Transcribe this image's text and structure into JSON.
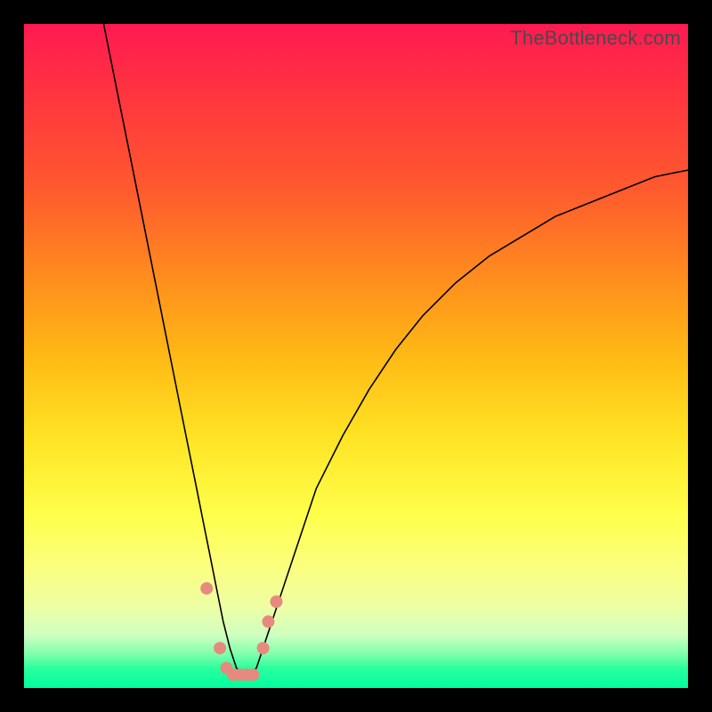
{
  "watermark": "TheBottleneck.com",
  "colors": {
    "frame": "#000000",
    "curve": "#000000",
    "marker": "#e78a7e",
    "gradient_stops": [
      "#ff1a52",
      "#ff5a2e",
      "#ffb915",
      "#ffff4b",
      "#edffa6",
      "#00ff9d"
    ]
  },
  "chart_data": {
    "type": "line",
    "title": "",
    "xlabel": "",
    "ylabel": "",
    "xlim": [
      0,
      100
    ],
    "ylim": [
      0,
      100
    ],
    "x": [
      12,
      14,
      16,
      18,
      20,
      22,
      24,
      26,
      27,
      28,
      29,
      30,
      31,
      32,
      33,
      34,
      35,
      36,
      38,
      40,
      42,
      44,
      48,
      52,
      56,
      60,
      65,
      70,
      75,
      80,
      85,
      90,
      95,
      100
    ],
    "y": [
      100,
      90,
      80,
      70,
      60,
      50,
      40,
      30,
      25,
      20,
      15,
      10,
      6,
      3,
      2,
      2,
      3,
      6,
      12,
      18,
      24,
      30,
      38,
      45,
      51,
      56,
      61,
      65,
      68,
      71,
      73,
      75,
      77,
      78
    ],
    "markers": {
      "x": [
        27.5,
        29.5,
        30.5,
        31.5,
        32.5,
        33.5,
        34.5,
        36.0,
        36.8,
        38.0
      ],
      "y": [
        15,
        6,
        3,
        2,
        2,
        2,
        2,
        6,
        10,
        13
      ]
    },
    "notes": "V-shaped bottleneck curve. Values are visual estimates (no axis ticks present). y≈0 at the trough near x≈32–34; left branch rises steeply to ~100 near x≈12; right branch rises with diminishing slope toward y≈78 at x=100."
  }
}
